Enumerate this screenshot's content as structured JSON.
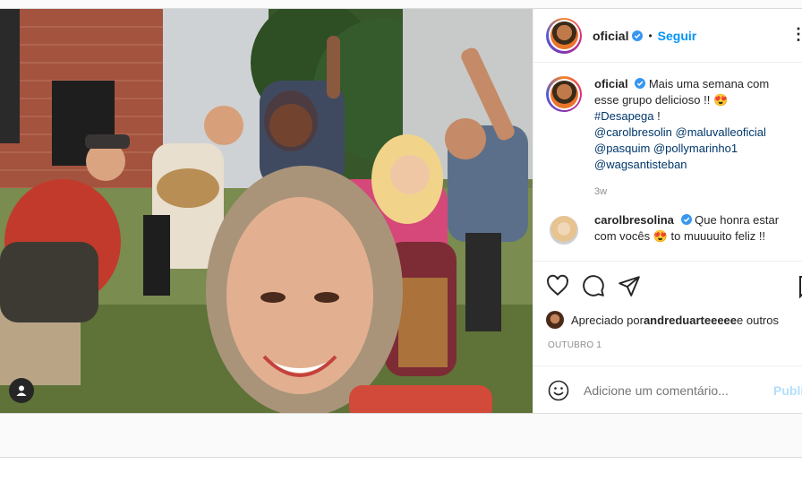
{
  "post": {
    "username": "oficial",
    "follow_label": "Seguir",
    "dot": "•",
    "more": "⋮"
  },
  "caption": {
    "username": "oficial",
    "text_before": "Mais uma semana com esse grupo delicioso !! ",
    "emoji": "😍",
    "hashtag": "#Desapega",
    "text_after": " !",
    "mentions": [
      "@carolbresolin",
      "@maluvalleoficial",
      "@pasquim",
      "@pollymarinho1",
      "@wagsantisteban"
    ],
    "age": "3w"
  },
  "comment": {
    "username": "carolbresolina",
    "text_before": "Que honra estar com vocês ",
    "emoji": "😍",
    "text_after": " to muuuuito feliz !!"
  },
  "likes": {
    "prefix": "Apreciado por ",
    "user": "andreduarteeeee",
    "suffix": " e outros"
  },
  "date": "OUTUBRO 1",
  "add_comment": {
    "placeholder": "Adicione um comentário...",
    "publish_label": "Publi"
  },
  "colors": {
    "accent": "#0095f6",
    "verified": "#3897f0",
    "publish_disabled": "#b2dffc"
  },
  "icons": [
    "verified-icon",
    "heart-icon",
    "comment-icon",
    "share-icon",
    "save-icon",
    "emoji-icon",
    "user-tag-icon"
  ]
}
